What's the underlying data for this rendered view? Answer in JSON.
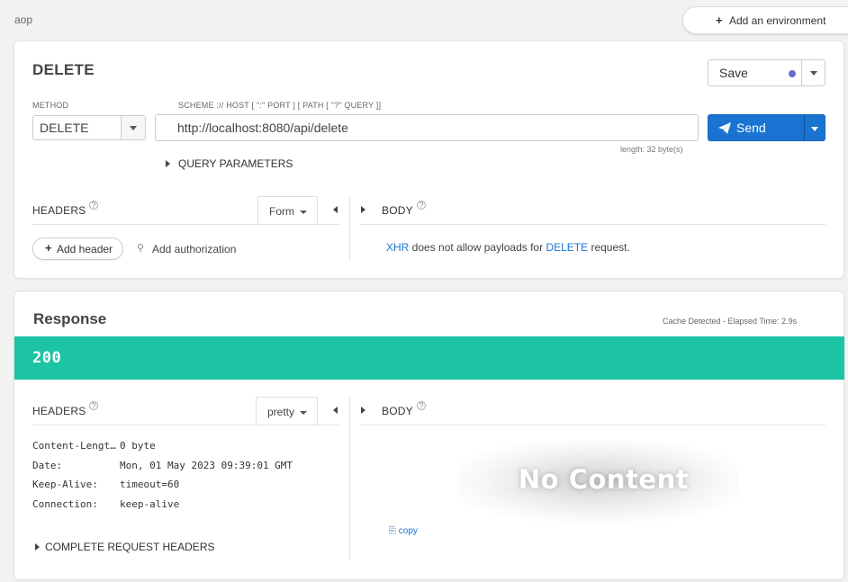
{
  "workspace": {
    "name": "aop"
  },
  "environment": {
    "add_label": "Add an environment"
  },
  "request": {
    "title": "DELETE",
    "save_label": "Save",
    "method_label": "METHOD",
    "method_value": "DELETE",
    "url_label": "SCHEME :// HOST [ \":\" PORT ] [ PATH [ \"?\" QUERY ]]",
    "url_value": "http://localhost:8080/api/delete",
    "length_label": "length: 32 byte(s)",
    "send_label": "Send",
    "query_params_label": "QUERY PARAMETERS",
    "headers_label": "HEADERS",
    "headers_mode": "Form",
    "body_label": "BODY",
    "add_header_label": "Add header",
    "add_auth_label": "Add authorization",
    "body_message": {
      "xhr": "XHR",
      "middle": " does not allow payloads for ",
      "method": "DELETE",
      "end": " request."
    }
  },
  "response": {
    "title": "Response",
    "cache_label": "Cache Detected - Elapsed Time: 2.9s",
    "status_code": "200",
    "headers_label": "HEADERS",
    "headers_mode": "pretty",
    "body_label": "BODY",
    "headers": [
      {
        "key": "Content-Length:",
        "value": "0 byte"
      },
      {
        "key": "Date:",
        "value": "Mon, 01 May 2023 09:39:01 GMT"
      },
      {
        "key": "Keep-Alive:",
        "value": "timeout=60"
      },
      {
        "key": "Connection:",
        "value": "keep-alive"
      }
    ],
    "complete_headers_label": "COMPLETE REQUEST HEADERS",
    "no_content_label": "No Content",
    "copy_label": "copy"
  },
  "colors": {
    "send_button": "#1a73d1",
    "status_success": "#1dc4a3",
    "save_dot": "#6a6ad0",
    "link": "#1a73d1"
  },
  "icons": [
    "plus-icon",
    "chevron-down-icon",
    "paper-plane-icon",
    "triangle-right-icon",
    "triangle-left-icon",
    "help-icon",
    "key-icon",
    "copy-icon"
  ]
}
